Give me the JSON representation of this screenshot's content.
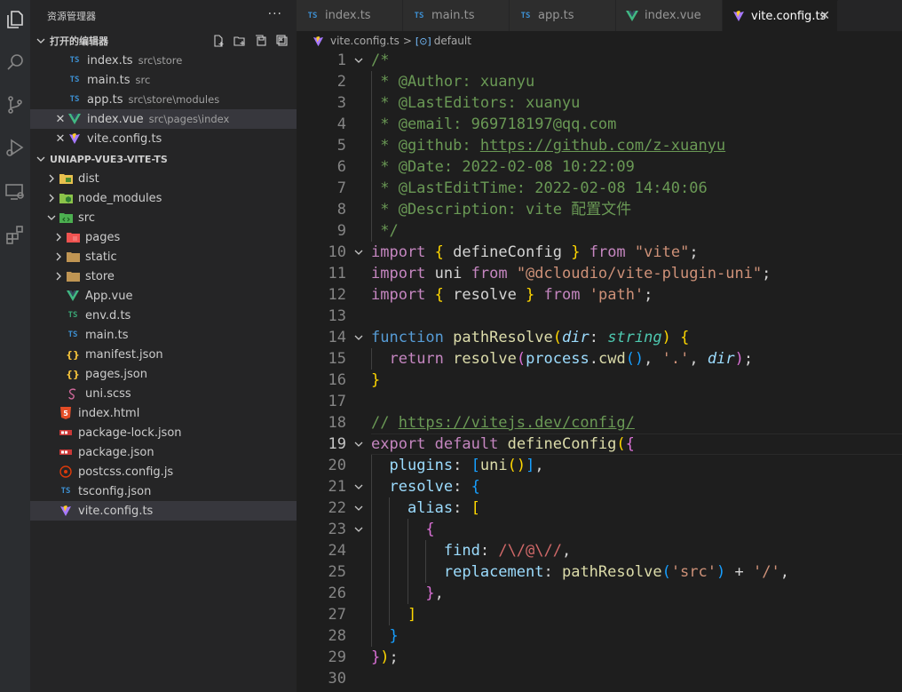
{
  "explorer": {
    "title": "资源管理器",
    "more": "···",
    "open_editors_label": "打开的编辑器",
    "project_label": "UNIAPP-VUE3-VITE-TS",
    "open_editors": [
      {
        "name": "index.ts",
        "path": "src\\store",
        "icon": "ts"
      },
      {
        "name": "main.ts",
        "path": "src",
        "icon": "ts"
      },
      {
        "name": "app.ts",
        "path": "src\\store\\modules",
        "icon": "ts"
      },
      {
        "name": "index.vue",
        "path": "src\\pages\\index",
        "icon": "vue"
      },
      {
        "name": "vite.config.ts",
        "path": "",
        "icon": "vite"
      }
    ],
    "tree": [
      {
        "name": "dist",
        "type": "folder"
      },
      {
        "name": "node_modules",
        "type": "folder"
      },
      {
        "name": "src",
        "type": "folder"
      },
      {
        "name": "pages",
        "type": "folder"
      },
      {
        "name": "static",
        "type": "folder"
      },
      {
        "name": "store",
        "type": "folder"
      },
      {
        "name": "App.vue",
        "type": "vue"
      },
      {
        "name": "env.d.ts",
        "type": "ts"
      },
      {
        "name": "main.ts",
        "type": "ts"
      },
      {
        "name": "manifest.json",
        "type": "json"
      },
      {
        "name": "pages.json",
        "type": "json"
      },
      {
        "name": "uni.scss",
        "type": "scss"
      },
      {
        "name": "index.html",
        "type": "html"
      },
      {
        "name": "package-lock.json",
        "type": "npm"
      },
      {
        "name": "package.json",
        "type": "npm"
      },
      {
        "name": "postcss.config.js",
        "type": "postcss"
      },
      {
        "name": "tsconfig.json",
        "type": "tsconfig"
      },
      {
        "name": "vite.config.ts",
        "type": "vite"
      }
    ]
  },
  "tabs": [
    {
      "label": "index.ts",
      "icon": "ts"
    },
    {
      "label": "main.ts",
      "icon": "ts"
    },
    {
      "label": "app.ts",
      "icon": "ts"
    },
    {
      "label": "index.vue",
      "icon": "vue"
    },
    {
      "label": "vite.config.ts",
      "icon": "vite",
      "close": "✕"
    }
  ],
  "breadcrumb": {
    "file": "vite.config.ts",
    "separator": ">",
    "symbol": "default"
  },
  "editor": {
    "lines": [
      [
        [
          "/*",
          "c-com"
        ]
      ],
      [
        [
          " * @Author: xuanyu",
          "c-com"
        ]
      ],
      [
        [
          " * @LastEditors: xuanyu",
          "c-com"
        ]
      ],
      [
        [
          " * @email: 969718197@qq.com",
          "c-com"
        ]
      ],
      [
        [
          " * @github: ",
          "c-com"
        ],
        [
          "https://github.com/z-xuanyu",
          "c-com c-link"
        ]
      ],
      [
        [
          " * @Date: 2022-02-08 10:22:09",
          "c-com"
        ]
      ],
      [
        [
          " * @LastEditTime: 2022-02-08 14:40:06",
          "c-com"
        ]
      ],
      [
        [
          " * @Description: vite 配置文件",
          "c-com"
        ]
      ],
      [
        [
          " */",
          "c-com"
        ]
      ],
      [
        [
          "import",
          "c-kw"
        ],
        [
          " ",
          "c-plain"
        ],
        [
          "{",
          "c-y"
        ],
        [
          " defineConfig ",
          "c-plain"
        ],
        [
          "}",
          "c-y"
        ],
        [
          " ",
          "c-plain"
        ],
        [
          "from",
          "c-kw"
        ],
        [
          " ",
          "c-plain"
        ],
        [
          "\"vite\"",
          "c-str"
        ],
        [
          ";",
          "c-plain"
        ]
      ],
      [
        [
          "import",
          "c-kw"
        ],
        [
          " uni ",
          "c-plain"
        ],
        [
          "from",
          "c-kw"
        ],
        [
          " ",
          "c-plain"
        ],
        [
          "\"@dcloudio/vite-plugin-uni\"",
          "c-str"
        ],
        [
          ";",
          "c-plain"
        ]
      ],
      [
        [
          "import",
          "c-kw"
        ],
        [
          " ",
          "c-plain"
        ],
        [
          "{",
          "c-y"
        ],
        [
          " resolve ",
          "c-plain"
        ],
        [
          "}",
          "c-y"
        ],
        [
          " ",
          "c-plain"
        ],
        [
          "from",
          "c-kw"
        ],
        [
          " ",
          "c-plain"
        ],
        [
          "'path'",
          "c-str"
        ],
        [
          ";",
          "c-plain"
        ]
      ],
      [],
      [
        [
          "function",
          "c-kwb"
        ],
        [
          " ",
          "c-plain"
        ],
        [
          "pathResolve",
          "c-fn"
        ],
        [
          "(",
          "c-y"
        ],
        [
          "dir",
          "c-par"
        ],
        [
          ": ",
          "c-plain"
        ],
        [
          "string",
          "c-type"
        ],
        [
          ")",
          "c-y"
        ],
        [
          " ",
          "c-plain"
        ],
        [
          "{",
          "c-y"
        ]
      ],
      [
        [
          "  ",
          "c-plain"
        ],
        [
          "return",
          "c-kw"
        ],
        [
          " ",
          "c-plain"
        ],
        [
          "resolve",
          "c-fn"
        ],
        [
          "(",
          "c-p"
        ],
        [
          "process",
          "c-var"
        ],
        [
          ".",
          "c-plain"
        ],
        [
          "cwd",
          "c-fn"
        ],
        [
          "()",
          "c-b"
        ],
        [
          ", ",
          "c-plain"
        ],
        [
          "'.'",
          "c-str"
        ],
        [
          ", ",
          "c-plain"
        ],
        [
          "dir",
          "c-par"
        ],
        [
          ")",
          "c-p"
        ],
        [
          ";",
          "c-plain"
        ]
      ],
      [
        [
          "}",
          "c-y"
        ]
      ],
      [],
      [
        [
          "// ",
          "c-com"
        ],
        [
          "https://vitejs.dev/config/",
          "c-com c-link"
        ]
      ],
      [
        [
          "export",
          "c-kw"
        ],
        [
          " ",
          "c-plain"
        ],
        [
          "default",
          "c-kw"
        ],
        [
          " ",
          "c-plain"
        ],
        [
          "defineConfig",
          "c-fn"
        ],
        [
          "(",
          "c-y"
        ],
        [
          "{",
          "c-p"
        ]
      ],
      [
        [
          "  ",
          "c-plain"
        ],
        [
          "plugins",
          "c-var"
        ],
        [
          ": ",
          "c-plain"
        ],
        [
          "[",
          "c-b"
        ],
        [
          "uni",
          "c-fn"
        ],
        [
          "()",
          "c-y"
        ],
        [
          "]",
          "c-b"
        ],
        [
          ",",
          "c-plain"
        ]
      ],
      [
        [
          "  ",
          "c-plain"
        ],
        [
          "resolve",
          "c-var"
        ],
        [
          ": ",
          "c-plain"
        ],
        [
          "{",
          "c-b"
        ]
      ],
      [
        [
          "    ",
          "c-plain"
        ],
        [
          "alias",
          "c-var"
        ],
        [
          ": ",
          "c-plain"
        ],
        [
          "[",
          "c-y"
        ]
      ],
      [
        [
          "      ",
          "c-plain"
        ],
        [
          "{",
          "c-p"
        ]
      ],
      [
        [
          "        ",
          "c-plain"
        ],
        [
          "find",
          "c-var"
        ],
        [
          ": ",
          "c-plain"
        ],
        [
          "/\\/@\\//",
          "c-re"
        ],
        [
          ",",
          "c-plain"
        ]
      ],
      [
        [
          "        ",
          "c-plain"
        ],
        [
          "replacement",
          "c-var"
        ],
        [
          ": ",
          "c-plain"
        ],
        [
          "pathResolve",
          "c-fn"
        ],
        [
          "(",
          "c-b"
        ],
        [
          "'src'",
          "c-str"
        ],
        [
          ")",
          "c-b"
        ],
        [
          " + ",
          "c-plain"
        ],
        [
          "'/'",
          "c-str"
        ],
        [
          ",",
          "c-plain"
        ]
      ],
      [
        [
          "      ",
          "c-plain"
        ],
        [
          "}",
          "c-p"
        ],
        [
          ",",
          "c-plain"
        ]
      ],
      [
        [
          "    ",
          "c-plain"
        ],
        [
          "]",
          "c-y"
        ]
      ],
      [
        [
          "  ",
          "c-plain"
        ],
        [
          "}",
          "c-b"
        ]
      ],
      [
        [
          "}",
          "c-p"
        ],
        [
          ")",
          "c-y"
        ],
        [
          ";",
          "c-plain"
        ]
      ],
      []
    ],
    "current_line": 19,
    "foldable_lines": [
      1,
      10,
      14,
      19,
      21,
      22,
      23
    ]
  }
}
